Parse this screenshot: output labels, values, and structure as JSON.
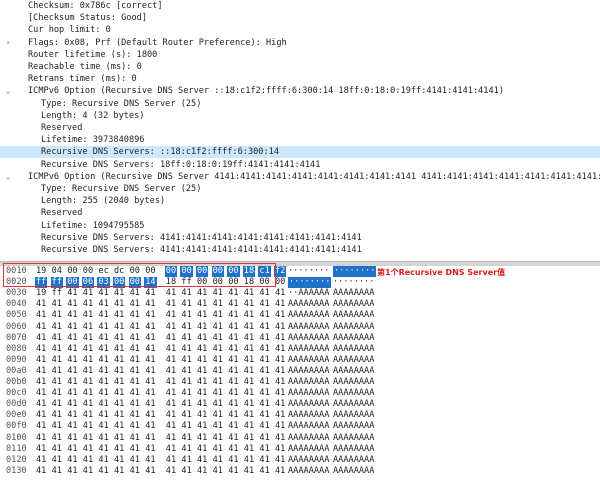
{
  "tree": [
    {
      "indent": 1,
      "arrow": "",
      "text": "Checksum: 0x786c [correct]"
    },
    {
      "indent": 1,
      "arrow": "",
      "text": "[Checksum Status: Good]"
    },
    {
      "indent": 1,
      "arrow": "",
      "text": "Cur hop limit: 0"
    },
    {
      "indent": 1,
      "arrow": ">",
      "text": "Flags: 0x08, Prf (Default Router Preference): High"
    },
    {
      "indent": 1,
      "arrow": "",
      "text": "Router lifetime (s): 1800"
    },
    {
      "indent": 1,
      "arrow": "",
      "text": "Reachable time (ms): 0"
    },
    {
      "indent": 1,
      "arrow": "",
      "text": "Retrans timer (ms): 0"
    },
    {
      "indent": 1,
      "arrow": "v",
      "text": "ICMPv6 Option (Recursive DNS Server ::18:c1f2:ffff:6:300:14 18ff:0:18:0:19ff:4141:4141:4141)"
    },
    {
      "indent": 2,
      "arrow": "",
      "text": "Type: Recursive DNS Server (25)"
    },
    {
      "indent": 2,
      "arrow": "",
      "text": "Length: 4 (32 bytes)"
    },
    {
      "indent": 2,
      "arrow": "",
      "text": "Reserved"
    },
    {
      "indent": 2,
      "arrow": "",
      "text": "Lifetime: 3973840896"
    },
    {
      "indent": 2,
      "arrow": "",
      "text": "Recursive DNS Servers: ::18:c1f2:ffff:6:300:14",
      "selected": true
    },
    {
      "indent": 2,
      "arrow": "",
      "text": "Recursive DNS Servers: 18ff:0:18:0:19ff:4141:4141:4141"
    },
    {
      "indent": 1,
      "arrow": "v",
      "text": "ICMPv6 Option (Recursive DNS Server 4141:4141:4141:4141:4141:4141:4141:4141 4141:4141:4141:4141:4141:4141:4141:4141:"
    },
    {
      "indent": 2,
      "arrow": "",
      "text": "Type: Recursive DNS Server (25)"
    },
    {
      "indent": 2,
      "arrow": "",
      "text": "Length: 255 (2040 bytes)"
    },
    {
      "indent": 2,
      "arrow": "",
      "text": "Reserved"
    },
    {
      "indent": 2,
      "arrow": "",
      "text": "Lifetime: 1094795585"
    },
    {
      "indent": 2,
      "arrow": "",
      "text": "Recursive DNS Servers: 4141:4141:4141:4141:4141:4141:4141:4141"
    },
    {
      "indent": 2,
      "arrow": "",
      "text": "Recursive DNS Servers: 4141:4141:4141:4141:4141:4141:4141:4141"
    }
  ],
  "hex_rows": [
    {
      "offset": "0010",
      "bytes": [
        "19",
        "04",
        "00",
        "00",
        "ec",
        "dc",
        "00",
        "00",
        "00",
        "00",
        "00",
        "00",
        "00",
        "18",
        "c1",
        "f2"
      ],
      "hl": [
        0,
        0,
        0,
        0,
        0,
        0,
        0,
        0,
        1,
        1,
        1,
        1,
        1,
        1,
        1,
        1
      ],
      "ascii1": "········",
      "ascii2": "········",
      "ahl1": false,
      "ahl2": true
    },
    {
      "offset": "0020",
      "bytes": [
        "ff",
        "ff",
        "00",
        "06",
        "03",
        "00",
        "00",
        "14",
        "18",
        "ff",
        "00",
        "00",
        "00",
        "18",
        "00",
        "00"
      ],
      "hl": [
        1,
        1,
        1,
        1,
        1,
        1,
        1,
        1,
        0,
        0,
        0,
        0,
        0,
        0,
        0,
        0
      ],
      "ascii1": "········",
      "ascii2": "········",
      "ahl1": true,
      "ahl2": false
    },
    {
      "offset": "0030",
      "bytes": [
        "19",
        "ff",
        "41",
        "41",
        "41",
        "41",
        "41",
        "41",
        "41",
        "41",
        "41",
        "41",
        "41",
        "41",
        "41",
        "41"
      ],
      "ascii1": "··AAAAAA",
      "ascii2": "AAAAAAAA"
    },
    {
      "offset": "0040",
      "bytes": [
        "41",
        "41",
        "41",
        "41",
        "41",
        "41",
        "41",
        "41",
        "41",
        "41",
        "41",
        "41",
        "41",
        "41",
        "41",
        "41"
      ],
      "ascii1": "AAAAAAAA",
      "ascii2": "AAAAAAAA"
    },
    {
      "offset": "0050",
      "bytes": [
        "41",
        "41",
        "41",
        "41",
        "41",
        "41",
        "41",
        "41",
        "41",
        "41",
        "41",
        "41",
        "41",
        "41",
        "41",
        "41"
      ],
      "ascii1": "AAAAAAAA",
      "ascii2": "AAAAAAAA"
    },
    {
      "offset": "0060",
      "bytes": [
        "41",
        "41",
        "41",
        "41",
        "41",
        "41",
        "41",
        "41",
        "41",
        "41",
        "41",
        "41",
        "41",
        "41",
        "41",
        "41"
      ],
      "ascii1": "AAAAAAAA",
      "ascii2": "AAAAAAAA"
    },
    {
      "offset": "0070",
      "bytes": [
        "41",
        "41",
        "41",
        "41",
        "41",
        "41",
        "41",
        "41",
        "41",
        "41",
        "41",
        "41",
        "41",
        "41",
        "41",
        "41"
      ],
      "ascii1": "AAAAAAAA",
      "ascii2": "AAAAAAAA"
    },
    {
      "offset": "0080",
      "bytes": [
        "41",
        "41",
        "41",
        "41",
        "41",
        "41",
        "41",
        "41",
        "41",
        "41",
        "41",
        "41",
        "41",
        "41",
        "41",
        "41"
      ],
      "ascii1": "AAAAAAAA",
      "ascii2": "AAAAAAAA"
    },
    {
      "offset": "0090",
      "bytes": [
        "41",
        "41",
        "41",
        "41",
        "41",
        "41",
        "41",
        "41",
        "41",
        "41",
        "41",
        "41",
        "41",
        "41",
        "41",
        "41"
      ],
      "ascii1": "AAAAAAAA",
      "ascii2": "AAAAAAAA"
    },
    {
      "offset": "00a0",
      "bytes": [
        "41",
        "41",
        "41",
        "41",
        "41",
        "41",
        "41",
        "41",
        "41",
        "41",
        "41",
        "41",
        "41",
        "41",
        "41",
        "41"
      ],
      "ascii1": "AAAAAAAA",
      "ascii2": "AAAAAAAA"
    },
    {
      "offset": "00b0",
      "bytes": [
        "41",
        "41",
        "41",
        "41",
        "41",
        "41",
        "41",
        "41",
        "41",
        "41",
        "41",
        "41",
        "41",
        "41",
        "41",
        "41"
      ],
      "ascii1": "AAAAAAAA",
      "ascii2": "AAAAAAAA"
    },
    {
      "offset": "00c0",
      "bytes": [
        "41",
        "41",
        "41",
        "41",
        "41",
        "41",
        "41",
        "41",
        "41",
        "41",
        "41",
        "41",
        "41",
        "41",
        "41",
        "41"
      ],
      "ascii1": "AAAAAAAA",
      "ascii2": "AAAAAAAA"
    },
    {
      "offset": "00d0",
      "bytes": [
        "41",
        "41",
        "41",
        "41",
        "41",
        "41",
        "41",
        "41",
        "41",
        "41",
        "41",
        "41",
        "41",
        "41",
        "41",
        "41"
      ],
      "ascii1": "AAAAAAAA",
      "ascii2": "AAAAAAAA"
    },
    {
      "offset": "00e0",
      "bytes": [
        "41",
        "41",
        "41",
        "41",
        "41",
        "41",
        "41",
        "41",
        "41",
        "41",
        "41",
        "41",
        "41",
        "41",
        "41",
        "41"
      ],
      "ascii1": "AAAAAAAA",
      "ascii2": "AAAAAAAA"
    },
    {
      "offset": "00f0",
      "bytes": [
        "41",
        "41",
        "41",
        "41",
        "41",
        "41",
        "41",
        "41",
        "41",
        "41",
        "41",
        "41",
        "41",
        "41",
        "41",
        "41"
      ],
      "ascii1": "AAAAAAAA",
      "ascii2": "AAAAAAAA"
    },
    {
      "offset": "0100",
      "bytes": [
        "41",
        "41",
        "41",
        "41",
        "41",
        "41",
        "41",
        "41",
        "41",
        "41",
        "41",
        "41",
        "41",
        "41",
        "41",
        "41"
      ],
      "ascii1": "AAAAAAAA",
      "ascii2": "AAAAAAAA"
    },
    {
      "offset": "0110",
      "bytes": [
        "41",
        "41",
        "41",
        "41",
        "41",
        "41",
        "41",
        "41",
        "41",
        "41",
        "41",
        "41",
        "41",
        "41",
        "41",
        "41"
      ],
      "ascii1": "AAAAAAAA",
      "ascii2": "AAAAAAAA"
    },
    {
      "offset": "0120",
      "bytes": [
        "41",
        "41",
        "41",
        "41",
        "41",
        "41",
        "41",
        "41",
        "41",
        "41",
        "41",
        "41",
        "41",
        "41",
        "41",
        "41"
      ],
      "ascii1": "AAAAAAAA",
      "ascii2": "AAAAAAAA"
    },
    {
      "offset": "0130",
      "bytes": [
        "41",
        "41",
        "41",
        "41",
        "41",
        "41",
        "41",
        "41",
        "41",
        "41",
        "41",
        "41",
        "41",
        "41",
        "41",
        "41"
      ],
      "ascii1": "AAAAAAAA",
      "ascii2": "AAAAAAAA"
    }
  ],
  "annotation": "第1个Recursive DNS Server值",
  "colors": {
    "selection": "#cce8ff",
    "byte_highlight": "#1e72c9",
    "annotation": "#e01b1b"
  },
  "icons": {
    "expanded": "chevron-down-icon",
    "collapsed": "chevron-right-icon"
  }
}
